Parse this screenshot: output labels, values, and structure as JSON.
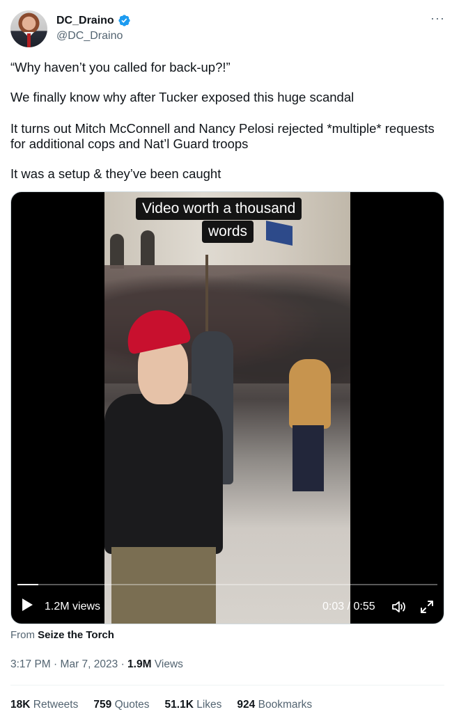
{
  "author": {
    "display_name": "DC_Draino",
    "handle": "@DC_Draino",
    "verified": true
  },
  "more_label": "···",
  "tweet_text": [
    "“Why haven’t you called for back-up?!”",
    "We finally know why after Tucker exposed this huge scandal",
    "It turns out Mitch McConnell and Nancy Pelosi rejected *multiple* requests for additional cops and Nat’l Guard troops",
    "It was a setup & they’ve been caught"
  ],
  "video": {
    "caption_line1": "Video worth a thousand",
    "caption_line2": "words",
    "views": "1.2M views",
    "time": "0:03 / 0:55",
    "progress": 0.05
  },
  "source": {
    "prefix": "From",
    "name": "Seize the Torch"
  },
  "meta": {
    "time": "3:17 PM",
    "sep1": "·",
    "date": "Mar 7, 2023",
    "sep2": "·",
    "views_count": "1.9M",
    "views_label": "Views"
  },
  "stats": {
    "retweets_count": "18K",
    "retweets_label": "Retweets",
    "quotes_count": "759",
    "quotes_label": "Quotes",
    "likes_count": "51.1K",
    "likes_label": "Likes",
    "bookmarks_count": "924",
    "bookmarks_label": "Bookmarks"
  },
  "colors": {
    "text": "#0f1419",
    "secondary": "#536471",
    "verified": "#1d9bf0"
  }
}
